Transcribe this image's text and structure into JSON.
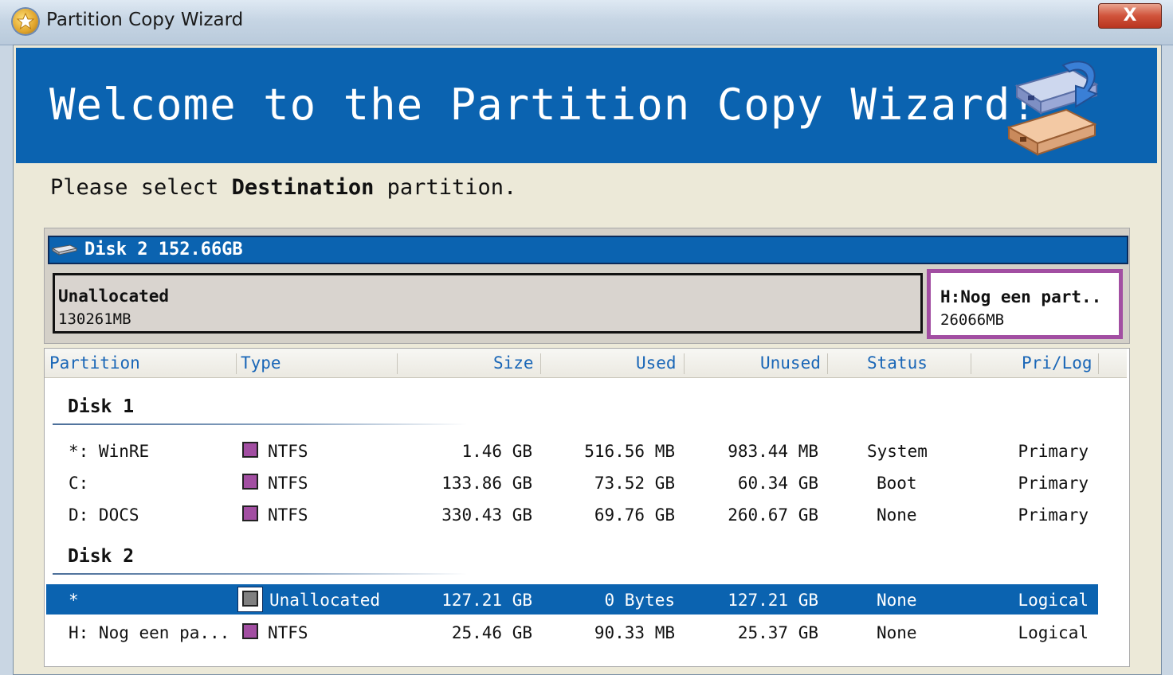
{
  "window": {
    "title": "Partition Copy Wizard",
    "close_label": "X"
  },
  "banner": {
    "title": "Welcome to the Partition Copy Wizard!"
  },
  "instruction": {
    "prefix": "Please select",
    "emphasis": "Destination",
    "suffix": "partition."
  },
  "disk_map": {
    "header": "Disk 2  152.66GB",
    "segments": [
      {
        "name": "Unallocated",
        "size": "130261MB"
      },
      {
        "name": "H:Nog een part..",
        "size": "26066MB",
        "color": "#a24ea2"
      }
    ]
  },
  "columns": [
    "Partition",
    "Type",
    "Size",
    "Used",
    "Unused",
    "Status",
    "Pri/Log"
  ],
  "groups": [
    {
      "label": "Disk 1",
      "rows": [
        {
          "partition": "*: WinRE",
          "type": "NTFS",
          "type_color": "#a24ea2",
          "size": "1.46 GB",
          "used": "516.56 MB",
          "unused": "983.44 MB",
          "status": "System",
          "prilog": "Primary"
        },
        {
          "partition": "C:",
          "type": "NTFS",
          "type_color": "#a24ea2",
          "size": "133.86 GB",
          "used": "73.52 GB",
          "unused": "60.34 GB",
          "status": "Boot",
          "prilog": "Primary"
        },
        {
          "partition": "D: DOCS",
          "type": "NTFS",
          "type_color": "#a24ea2",
          "size": "330.43 GB",
          "used": "69.76 GB",
          "unused": "260.67 GB",
          "status": "None",
          "prilog": "Primary"
        }
      ]
    },
    {
      "label": "Disk 2",
      "rows": [
        {
          "partition": "*",
          "type": "Unallocated",
          "type_color": "#808080",
          "size": "127.21 GB",
          "used": "0 Bytes",
          "unused": "127.21 GB",
          "status": "None",
          "prilog": "Logical",
          "selected": true
        },
        {
          "partition": "H: Nog een pa...",
          "type": "NTFS",
          "type_color": "#a24ea2",
          "size": "25.46 GB",
          "used": "90.33 MB",
          "unused": "25.37 GB",
          "status": "None",
          "prilog": "Logical"
        }
      ]
    }
  ],
  "colors": {
    "accent": "#0b63b0",
    "ntfs": "#a24ea2",
    "unallocated": "#808080",
    "header_text": "#1966b7"
  },
  "icons": [
    "wizard-star-icon",
    "close-icon",
    "disk-copy-icon",
    "hard-disk-icon"
  ]
}
